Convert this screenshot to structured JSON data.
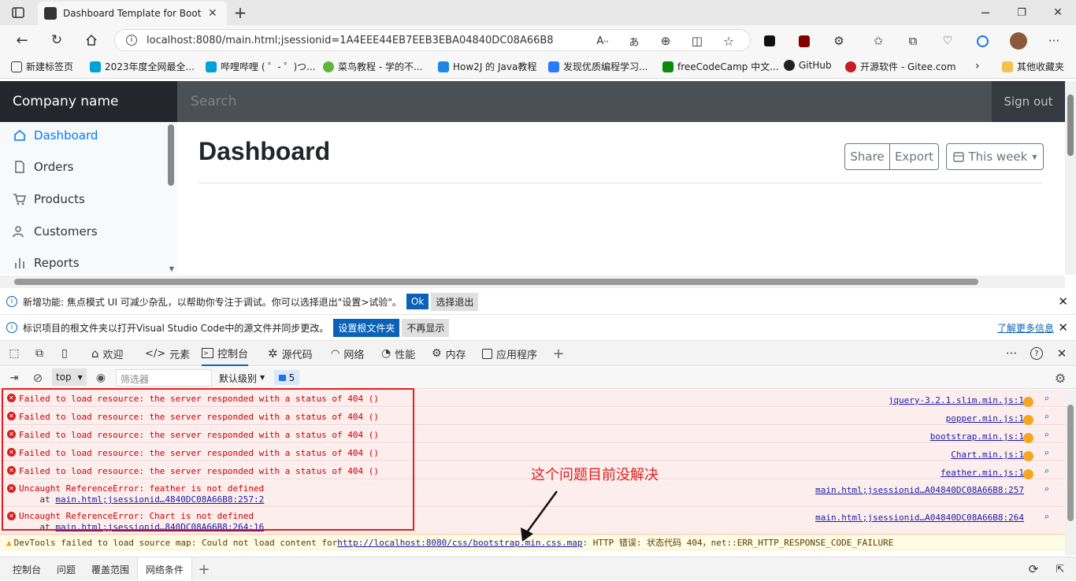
{
  "browser": {
    "tab_title": "Dashboard Template for Bootstra",
    "url": "localhost:8080/main.html;jsessionid=1A4EEE44EB7EEB3EBA04840DC08A66B8",
    "bookmarks": [
      {
        "label": "新建标签页",
        "color": "#333333"
      },
      {
        "label": "2023年度全网最全...",
        "color": "#00a1d6"
      },
      {
        "label": "哔哩哔哩 ( ゜- ゜)つ...",
        "color": "#00a1d6"
      },
      {
        "label": "菜鸟教程 - 学的不...",
        "color": "#5fb43b"
      },
      {
        "label": "How2J 的 Java教程",
        "color": "#1e88e5"
      },
      {
        "label": "发现优质编程学习...",
        "color": "#2979ff"
      },
      {
        "label": "freeCodeCamp 中文...",
        "color": "#0a8a0a"
      },
      {
        "label": "GitHub",
        "color": "#222222"
      },
      {
        "label": "开源软件 - Gitee.com",
        "color": "#c71d23"
      }
    ],
    "other_bookmarks": "其他收藏夹"
  },
  "page": {
    "brand": "Company name",
    "search_placeholder": "Search",
    "signout": "Sign out",
    "sidebar": [
      "Dashboard",
      "Orders",
      "Products",
      "Customers",
      "Reports"
    ],
    "heading": "Dashboard",
    "share": "Share",
    "export": "Export",
    "period": "This week"
  },
  "devtools": {
    "info1": {
      "text": "新增功能: 焦点模式 UI 可减少杂乱，以帮助你专注于调试。你可以选择退出\"设置>试验\"。",
      "ok": "Ok",
      "optout": "选择退出"
    },
    "info2": {
      "text": "标识项目的根文件夹以打开Visual Studio Code中的源文件并同步更改。",
      "setroot": "设置根文件夹",
      "dontshow": "不再显示",
      "learnmore": "了解更多信息"
    },
    "tabs": [
      "欢迎",
      "元素",
      "控制台",
      "源代码",
      "网络",
      "性能",
      "内存",
      "应用程序"
    ],
    "toolbar": {
      "context": "top",
      "filter_placeholder": "筛选器",
      "level": "默认级别",
      "count": "5"
    },
    "errors": [
      {
        "msg": "Failed to load resource: the server responded with a status of 404 ()",
        "src": "jquery-3.2.1.slim.min.js:1"
      },
      {
        "msg": "Failed to load resource: the server responded with a status of 404 ()",
        "src": "popper.min.js:1"
      },
      {
        "msg": "Failed to load resource: the server responded with a status of 404 ()",
        "src": "bootstrap.min.js:1"
      },
      {
        "msg": "Failed to load resource: the server responded with a status of 404 ()",
        "src": "Chart.min.js:1"
      },
      {
        "msg": "Failed to load resource: the server responded with a status of 404 ()",
        "src": "feather.min.js:1"
      }
    ],
    "ref_errors": [
      {
        "msg": "Uncaught ReferenceError: feather is not defined",
        "at": "    at ",
        "link": "main.html;jsessionid…4840DC08A66B8:257:2",
        "src": "main.html;jsessionid…A04840DC08A66B8:257"
      },
      {
        "msg": "Uncaught ReferenceError: Chart is not defined",
        "at": "    at ",
        "link": "main.html;jsessionid…840DC08A66B8:264:16",
        "src": "main.html;jsessionid…A04840DC08A66B8:264"
      }
    ],
    "warning": {
      "prefix": "DevTools failed to load source map: Could not load content for ",
      "link": "http://localhost:8080/css/bootstrap.min.css.map",
      "suffix": ": HTTP 错误: 状态代码 404，net::ERR_HTTP_RESPONSE_CODE_FAILURE"
    },
    "annotation": "这个问题目前没解决",
    "drawer_tabs": [
      "控制台",
      "问题",
      "覆盖范围",
      "网络条件"
    ]
  }
}
